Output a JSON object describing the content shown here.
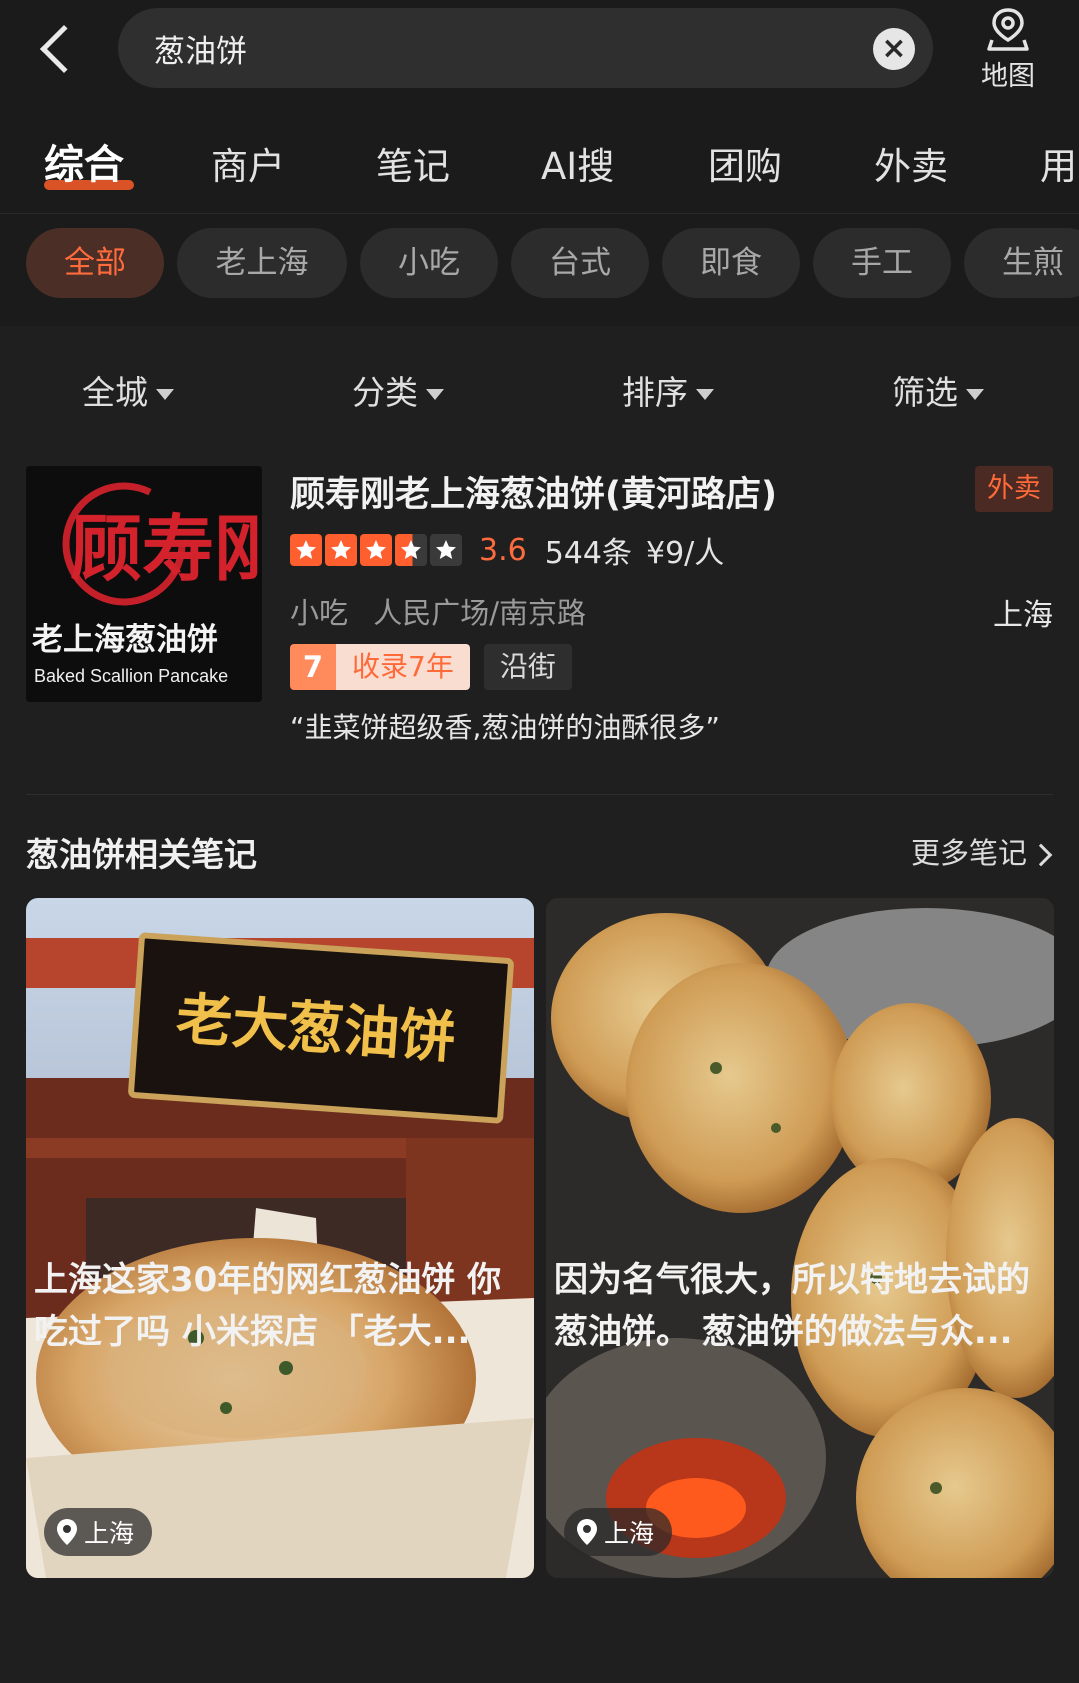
{
  "search": {
    "query": "葱油饼",
    "map_label": "地图"
  },
  "tabs": [
    "综合",
    "商户",
    "笔记",
    "AI搜",
    "团购",
    "外卖",
    "用"
  ],
  "chips": [
    "全部",
    "老上海",
    "小吃",
    "台式",
    "即食",
    "手工",
    "生煎"
  ],
  "filters": [
    "全城",
    "分类",
    "排序",
    "筛选"
  ],
  "shop": {
    "name": "顾寿刚老上海葱油饼(黄河路店)",
    "badge": "外卖",
    "rating": 3.6,
    "rating_text": "3.6",
    "reviews": "544条",
    "price": "¥9/人",
    "category": "小吃",
    "area": "人民广场/南京路",
    "city": "上海",
    "years_num": "7",
    "years_text": "收录7年",
    "street_tag": "沿街",
    "quote": "“韭菜饼超级香,葱油饼的油酥很多”",
    "logo_text_cn": "老上海葱油饼",
    "logo_text_en": "Baked Scallion Pancake",
    "logo_brand": "顾寿刚"
  },
  "notes": {
    "title": "葱油饼相关笔记",
    "more": "更多笔记",
    "cards": [
      {
        "location": "上海",
        "line1": "上海这家30年的网红葱油饼 你",
        "line2": "吃过了吗 小米探店 「老大...",
        "sign_text": "老大葱油饼"
      },
      {
        "location": "上海",
        "line1": "因为名气很大，所以特地去试的",
        "line2": "葱油饼。 葱油饼的做法与众..."
      }
    ]
  },
  "colors": {
    "accent": "#ff6b3d",
    "background": "#1b1b1b"
  }
}
